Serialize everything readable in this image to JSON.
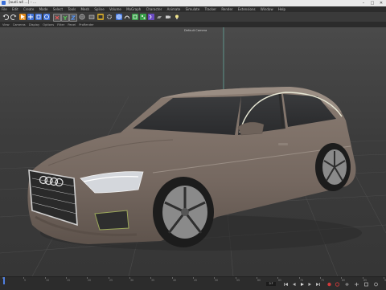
{
  "window": {
    "title": "[audi a4 ...] - ...",
    "controls": [
      "–",
      "□",
      "✕"
    ]
  },
  "menubar": {
    "items": [
      "File",
      "Edit",
      "Create",
      "Mode",
      "Select",
      "Tools",
      "Mesh",
      "Spline",
      "Volume",
      "MoGraph",
      "Character",
      "Animate",
      "Simulate",
      "Tracker",
      "Render",
      "Extensions",
      "Window",
      "Help"
    ]
  },
  "toolbar": {
    "icons": [
      "undo-icon",
      "redo-icon",
      "live-select-icon",
      "move-icon",
      "scale-icon",
      "rotate-icon",
      "x-axis-icon",
      "y-axis-icon",
      "z-axis-icon",
      "world-coordinate-icon",
      "render-view-icon",
      "render-picture-icon",
      "render-settings-icon",
      "cube-icon",
      "pen-spline-icon",
      "subdivision-icon",
      "cloner-icon",
      "deformer-icon",
      "floor-icon",
      "camera-icon",
      "light-icon"
    ]
  },
  "viewport_menu": {
    "items": [
      "View",
      "Cameras",
      "Display",
      "Options",
      "Filter",
      "Panel",
      "ProRender"
    ]
  },
  "viewport": {
    "camera_label": "Default Camera"
  },
  "timeline": {
    "tick_labels": [
      "0",
      "5",
      "10",
      "15",
      "20",
      "25",
      "30",
      "35",
      "40",
      "45",
      "50",
      "55",
      "60",
      "65",
      "70",
      "75",
      "80",
      "85",
      "90"
    ],
    "current_frame": "0 F",
    "playhead_frame": 0
  },
  "colors": {
    "accent": "#4f7fe0",
    "viewport_bg": "#3e3e3e",
    "car_body": "#7a6c62"
  }
}
